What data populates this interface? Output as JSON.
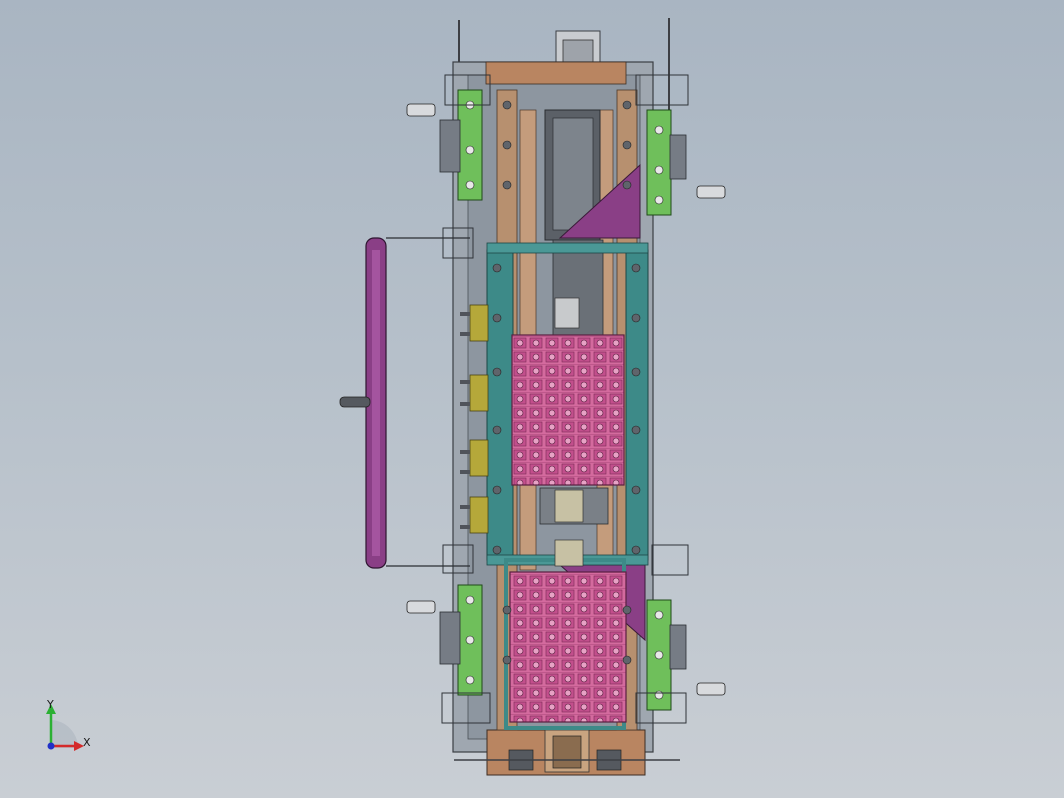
{
  "view": {
    "type": "CAD assembly top view",
    "background": "#b3bdc8"
  },
  "colors": {
    "frame": "#9aa3ad",
    "rail": "#3c8a87",
    "pink": "#c7558f",
    "purple": "#8a3d86",
    "green": "#6fc05a",
    "tan": "#b58a66",
    "olive": "#b6a83a",
    "dark": "#444a52",
    "bronze": "#b07a52"
  },
  "triad": {
    "x_label": "X",
    "y_label": "Y",
    "x_color": "#d42a2a",
    "y_color": "#2bb033",
    "z_color": "#2030c8"
  },
  "icons": {
    "triad": "coordinate-triad-icon"
  }
}
